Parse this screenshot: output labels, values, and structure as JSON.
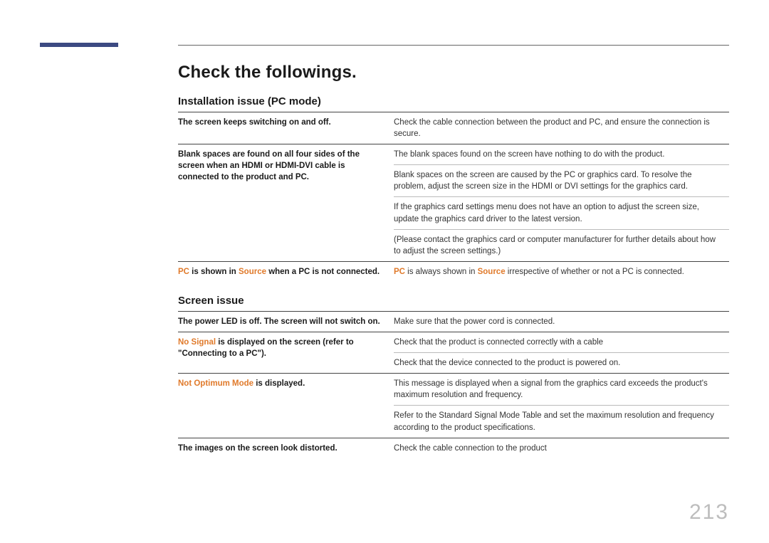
{
  "page_number": "213",
  "heading": "Check the followings.",
  "section1": {
    "title": "Installation issue (PC mode)",
    "rows": {
      "r0": {
        "left": "The screen keeps switching on and off.",
        "right": "Check the cable connection between the product and PC, and ensure the connection is secure."
      },
      "r1": {
        "left": "Blank spaces are found on all four sides of the screen when an HDMI or HDMI-DVI cable is connected to the product and PC.",
        "r_a": "The blank spaces found on the screen have nothing to do with the product.",
        "r_b": "Blank spaces on the screen are caused by the PC or graphics card. To resolve the problem, adjust the screen size in the HDMI or DVI settings for the graphics card.",
        "r_c": "If the graphics card settings menu does not have an option to adjust the screen size, update the graphics card driver to the latest version.",
        "r_d": "(Please contact the graphics card or computer manufacturer for further details about how to adjust the screen settings.)"
      },
      "r2": {
        "l_hl1": "PC",
        "l_mid": " is shown in ",
        "l_hl2": "Source",
        "l_end": " when a PC is not connected.",
        "r_hl1": "PC",
        "r_mid": " is always shown in ",
        "r_hl2": "Source",
        "r_end": " irrespective of whether or not a PC is connected."
      }
    }
  },
  "section2": {
    "title": "Screen issue",
    "rows": {
      "r0": {
        "left": "The power LED is off. The screen will not switch on.",
        "right": "Make sure that the power cord is connected."
      },
      "r1": {
        "l_hl": "No Signal",
        "l_rest": " is displayed on the screen (refer to \"Connecting to a PC\").",
        "r_a": "Check that the product is connected correctly with a cable",
        "r_b": "Check that the device connected to the product is powered on."
      },
      "r2": {
        "l_hl": "Not Optimum Mode",
        "l_rest": " is displayed.",
        "r_a": "This message is displayed when a signal from the graphics card exceeds the product's maximum resolution and frequency.",
        "r_b": "Refer to the Standard Signal Mode Table and set the maximum resolution and frequency according to the product specifications."
      },
      "r3": {
        "left": "The images on the screen look distorted.",
        "right": "Check the cable connection to the product"
      }
    }
  }
}
